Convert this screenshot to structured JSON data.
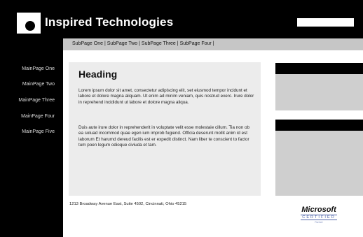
{
  "header": {
    "title": "Inspired Technologies",
    "logo_icon": "circle-in-square-logo",
    "search_value": ""
  },
  "subnav": {
    "items": [
      "SubPage One",
      "SubPage Two",
      "SubPage Three",
      "SubPage Four"
    ],
    "separator": "|"
  },
  "sidebar": {
    "items": [
      "MainPage One",
      "MainPage Two",
      "MainPage Three",
      "MainPage Four",
      "MainPage Five"
    ]
  },
  "main": {
    "heading": "Heading",
    "paragraphs": [
      "Lorem ipsum dolor sit amet, consectetur adipiscing elit, set eiusmod tempor incidunt et labore et dolore magna aliquam. Ut enim ad minim veniam, quis nostrud exerc. Irure dolor in reprehend incididunt ut labore et dolore magna aliqua.",
      "Duis aute irure dolor in reprehenderit in voluptate velit esse molestaie cillum. Tia non ob ea soluad incommod quae egen ium improb fugiend. Officia deserunt mollit anim id est laborum Et harumd dereud facilis est er expedit distinct. Nam liber te conscient to factor tum poen legum odioque civiuda et tam."
    ]
  },
  "footer": {
    "address": "1213 Broadway Avenue East, Suite 4502, Cincinnati, Ohio 45215"
  },
  "badge": {
    "brand": "Microsoft",
    "line1": "CERTIFIED",
    "line2": "Partner"
  },
  "colors": {
    "header_bg": "#000000",
    "subnav_bg": "#c6c6c6",
    "content_bg": "#ececec",
    "right_box_bg": "#cfcfcf"
  }
}
